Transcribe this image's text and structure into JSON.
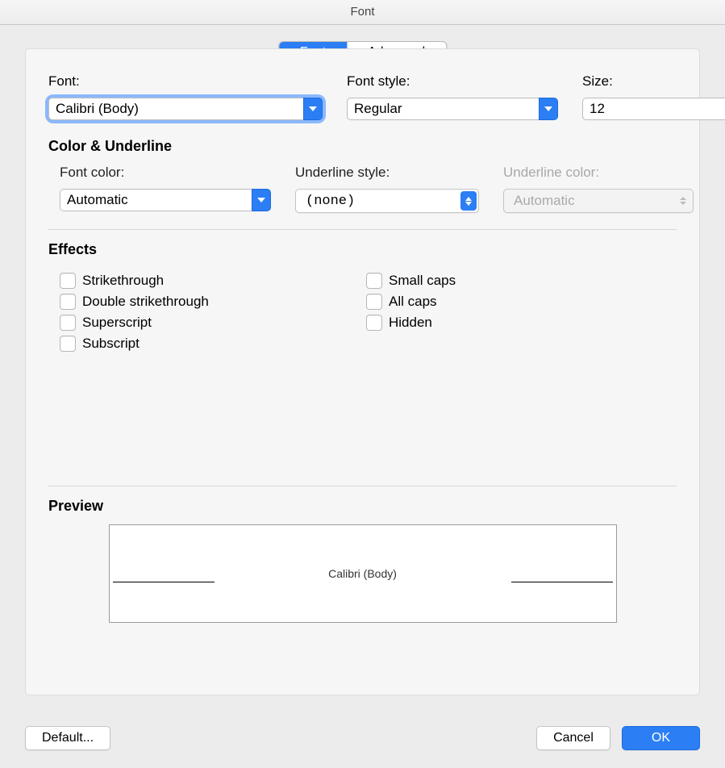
{
  "window": {
    "title": "Font"
  },
  "tabs": {
    "font": "Font",
    "advanced": "Advanced",
    "active": "font"
  },
  "fields": {
    "font": {
      "label": "Font:",
      "value": "Calibri (Body)"
    },
    "font_style": {
      "label": "Font style:",
      "value": "Regular"
    },
    "size": {
      "label": "Size:",
      "value": "12"
    }
  },
  "color_underline": {
    "heading": "Color & Underline",
    "font_color": {
      "label": "Font color:",
      "value": "Automatic"
    },
    "underline_style": {
      "label": "Underline style:",
      "value": "(none)"
    },
    "underline_color": {
      "label": "Underline color:",
      "value": "Automatic",
      "disabled": true
    }
  },
  "effects": {
    "heading": "Effects",
    "left": [
      "Strikethrough",
      "Double strikethrough",
      "Superscript",
      "Subscript"
    ],
    "right": [
      "Small caps",
      "All caps",
      "Hidden"
    ]
  },
  "preview": {
    "heading": "Preview",
    "sample": "Calibri (Body)"
  },
  "buttons": {
    "default": "Default...",
    "cancel": "Cancel",
    "ok": "OK"
  }
}
